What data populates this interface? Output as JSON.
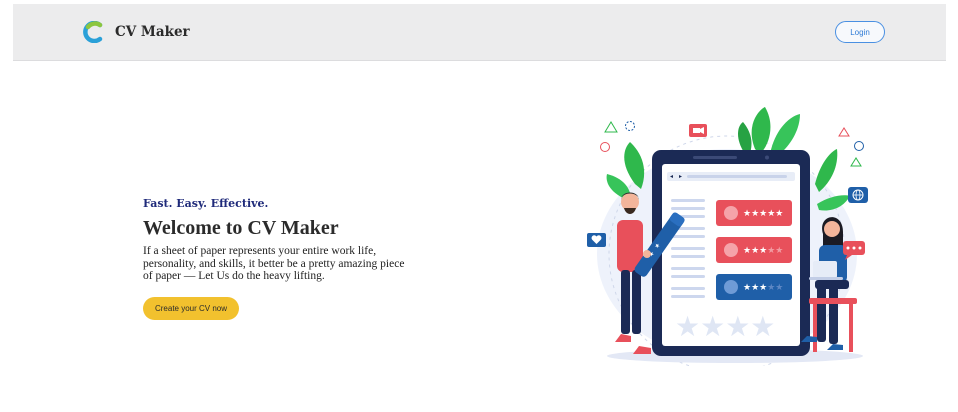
{
  "navbar": {
    "brand_name": "CV Maker",
    "login_label": "Login"
  },
  "hero": {
    "tagline": "Fast. Easy. Effective.",
    "title": "Welcome to CV Maker",
    "description": "If a sheet of paper represents your entire work life, personality, and skills, it better be a pretty amazing piece of paper — Let Us do the heavy lifting.",
    "cta_label": "Create your CV now"
  },
  "illustration": {
    "icons": [
      "video-icon",
      "heart-icon",
      "globe-icon",
      "chat-icon",
      "star-icon"
    ],
    "review_ratings": [
      5,
      3,
      3
    ]
  },
  "colors": {
    "accent": "#f2c12e",
    "login_border": "#4a90e2",
    "tagline": "#1f2a7a",
    "navbar_bg": "#ececed",
    "card_red": "#e8505b",
    "card_blue": "#1f5fa8",
    "leaf_green": "#2fb84c"
  }
}
